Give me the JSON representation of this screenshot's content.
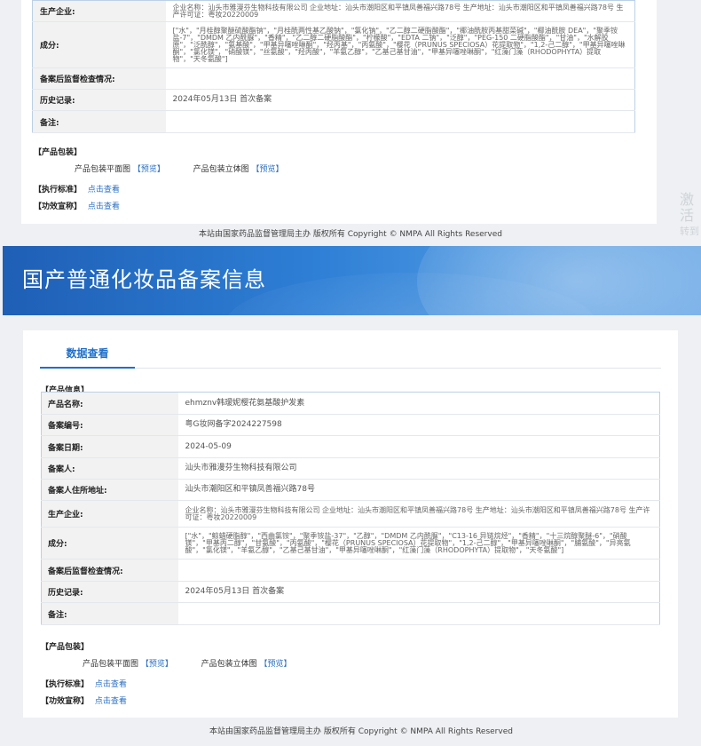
{
  "top_panel": {
    "rows": [
      {
        "label": "生产企业:",
        "value": "企业名称：汕头市雅漫芬生物科技有限公司 企业地址：汕头市潮阳区和平镇凤善福兴路78号 生产地址：汕头市潮阳区和平镇凤善福兴路78号 生产许可证：粤妆20220009"
      },
      {
        "label": "成分:",
        "value": "[\"水\"，\"月桂醇聚醚硫酸酯钠\"，\"月桂酰两性基乙酸钠\"，\"氯化钠\"，\"乙二醇二硬脂酸酯\"，\"椰油酰胺丙基甜菜碱\"，\"椰油酰胺 DEA\"，\"聚季铵盐-7\"，\"DMDM 乙内酰脲\"，\"香精\"，\"乙二醇二硬脂酸酯\"，\"柠檬酸\"，\"EDTA 二钠\"，\"泛醇\"，\"PEG-150 二硬脂酸酯\"，\"甘油\"，\"水解胶原\"，\"泛酰醇\"，\"氨基酸\"，\"甲基异噻唑啉酮\"，\"羟丙基\"，\"丙氨酸\"，\"樱花（PRUNUS SPECIOSA）花提取物\"，\"1,2-己二醇\"，\"甲基异噻唑啉酮\"，\"氯化镁\"，\"硝酸镁\"，\"丝氨酸\"，\"羟丙酸\"，\"羊氨乙醇\"，\"乙基己基甘油\"，\"甲基异噻唑啉酮\"，\"红藻门藻（RHODOPHYTA）提取物\"，\"天冬氨酸\"]"
      },
      {
        "label": "备案后监督检查情况:",
        "value": ""
      },
      {
        "label": "历史记录:",
        "value": "2024年05月13日 首次备案"
      },
      {
        "label": "备注:",
        "value": ""
      }
    ],
    "package_header": "【产品包装】",
    "flat_label": "产品包装平面图",
    "stereo_label": "产品包装立体图",
    "preview_label": "【预览】",
    "standard_label": "【执行标准】",
    "efficacy_label": "【功效宣称】",
    "view_link": "点击查看",
    "footer": "本站由国家药品监督管理局主办 版权所有 Copyright © NMPA All Rights Reserved"
  },
  "watermark": {
    "line1": "激活",
    "line2": "转到"
  },
  "banner": {
    "title": "国产普通化妆品备案信息"
  },
  "main_panel": {
    "tab": "数据查看",
    "section_header": "【产品信息】",
    "rows": [
      {
        "label": "产品名称:",
        "value": "ehmznv韩瑷妮樱花氨基酸护发素"
      },
      {
        "label": "备案编号:",
        "value": "粤G妆网备字2024227598"
      },
      {
        "label": "备案日期:",
        "value": "2024-05-09"
      },
      {
        "label": "备案人:",
        "value": "汕头市雅漫芬生物科技有限公司"
      },
      {
        "label": "备案人住所地址:",
        "value": "汕头市潮阳区和平镇凤善福兴路78号"
      },
      {
        "label": "生产企业:",
        "value": "企业名称：汕头市雅漫芬生物科技有限公司 企业地址：汕头市潮阳区和平镇凤善福兴路78号 生产地址：汕头市潮阳区和平镇凤善福兴路78号 生产许可证：粤妆20220009"
      },
      {
        "label": "成分:",
        "value": "[\"水\"，\"鲸蜡硬脂醇\"，\"西曲氯铵\"，\"聚季铵盐-37\"，\"乙醇\"，\"DMDM 乙内酰脲\"，\"C13-16 异链烷烃\"，\"香精\"，\"十三烷醇聚醚-6\"，\"硝酸镁\"，\"甲基丙二醇\"，\"甘氨酸\"，\"丙氨酸\"，\"樱花（PRUNUS SPECIOSA）花提取物\"，\"1,2-己二醇\"，\"甲基异噻唑啉酮\"，\"脯氨酸\"，\"异亮氨酸\"，\"氯化镁\"，\"羊氨乙醇\"，\"乙基己基甘油\"，\"甲基异噻唑啉酮\"，\"红藻门藻（RHODOPHYTA）提取物\"，\"天冬氨酸\"]"
      },
      {
        "label": "备案后监督检查情况:",
        "value": ""
      },
      {
        "label": "历史记录:",
        "value": "2024年05月13日 首次备案"
      },
      {
        "label": "备注:",
        "value": ""
      }
    ],
    "package_header": "【产品包装】",
    "flat_label": "产品包装平面图",
    "stereo_label": "产品包装立体图",
    "preview_label": "【预览】",
    "standard_label": "【执行标准】",
    "efficacy_label": "【功效宣称】",
    "view_link": "点击查看",
    "footer": "本站由国家药品监督管理局主办 版权所有 Copyright © NMPA All Rights Reserved"
  },
  "colors": {
    "accent": "#1f6fc9",
    "link": "#2a6fc2",
    "banner_start": "#1f5fb6",
    "banner_end": "#6aa8e6",
    "label_bg": "#f2f2f2",
    "table_border": "#bcd0e6"
  }
}
